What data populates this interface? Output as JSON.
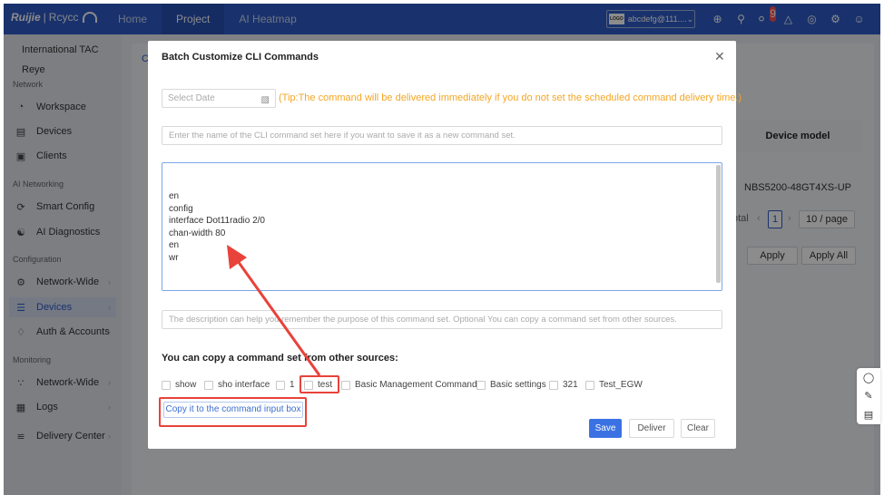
{
  "brand": {
    "name": "Ruijie",
    "separator": "|",
    "sub": "Rcycc"
  },
  "topnav": [
    {
      "label": "Home",
      "active": false
    },
    {
      "label": "Project",
      "active": true
    },
    {
      "label": "AI Heatmap",
      "active": false
    }
  ],
  "tenant_selector": {
    "logo": "LOGO",
    "value": "abcdefg@111...."
  },
  "notifications": {
    "count": "9"
  },
  "sidebar": {
    "tenant_name": "International TAC Reye",
    "groups": [
      {
        "label": "Network",
        "items": [
          {
            "label": "Workspace",
            "icon": "gauge-icon"
          },
          {
            "label": "Devices",
            "icon": "device-icon"
          },
          {
            "label": "Clients",
            "icon": "clients-icon"
          }
        ]
      },
      {
        "label": "AI Networking",
        "items": [
          {
            "label": "Smart Config",
            "icon": "smart-config-icon"
          },
          {
            "label": "AI Diagnostics",
            "icon": "ai-diagnostics-icon"
          }
        ]
      },
      {
        "label": "Configuration",
        "items": [
          {
            "label": "Network-Wide",
            "icon": "gear-icon"
          },
          {
            "label": "Devices",
            "icon": "sliders-icon",
            "active": true
          },
          {
            "label": "Auth & Accounts",
            "icon": "shield-icon"
          }
        ]
      },
      {
        "label": "Monitoring",
        "items": [
          {
            "label": "Network-Wide",
            "icon": "topology-icon"
          },
          {
            "label": "Logs",
            "icon": "logs-icon"
          },
          {
            "label": "Delivery Center",
            "icon": "delivery-icon"
          }
        ]
      }
    ]
  },
  "background": {
    "tab_initial": "C",
    "column_header": "Device model",
    "device_model": "NBS5200-48GT4XS-UP",
    "pagination": {
      "total_label": "otal",
      "page": "1",
      "page_size": "10 / page"
    },
    "apply_label": "Apply",
    "apply_all_label": "Apply All"
  },
  "modal": {
    "title": "Batch Customize CLI Commands",
    "date_placeholder": "Select Date",
    "tip": "(Tip:The command will be delivered immediately if you do not set the scheduled command delivery time.)",
    "name_placeholder": "Enter the name of the CLI command set here if you want to save it as a new command set.",
    "cli_lines": [
      "en",
      "config",
      "interface Dot11radio 2/0",
      "chan-width 80",
      "en",
      "wr"
    ],
    "description_placeholder": "The description can help you remember the purpose of this command set. Optional You can copy a command set from other sources.",
    "copy_title": "You can copy a command set from other sources:",
    "command_sets": [
      "show",
      "sho interface",
      "1",
      "test",
      "Basic Management Commands",
      "Basic settings",
      "321",
      "Test_EGW"
    ],
    "copy_button": "Copy it to the command input box",
    "save_button": "Save",
    "deliver_button": "Deliver",
    "clear_button": "Clear"
  },
  "colors": {
    "brand_blue": "#2e5bc6",
    "primary": "#3b72e3",
    "tip_orange": "#f5a623",
    "annotation_red": "#e8423a"
  }
}
